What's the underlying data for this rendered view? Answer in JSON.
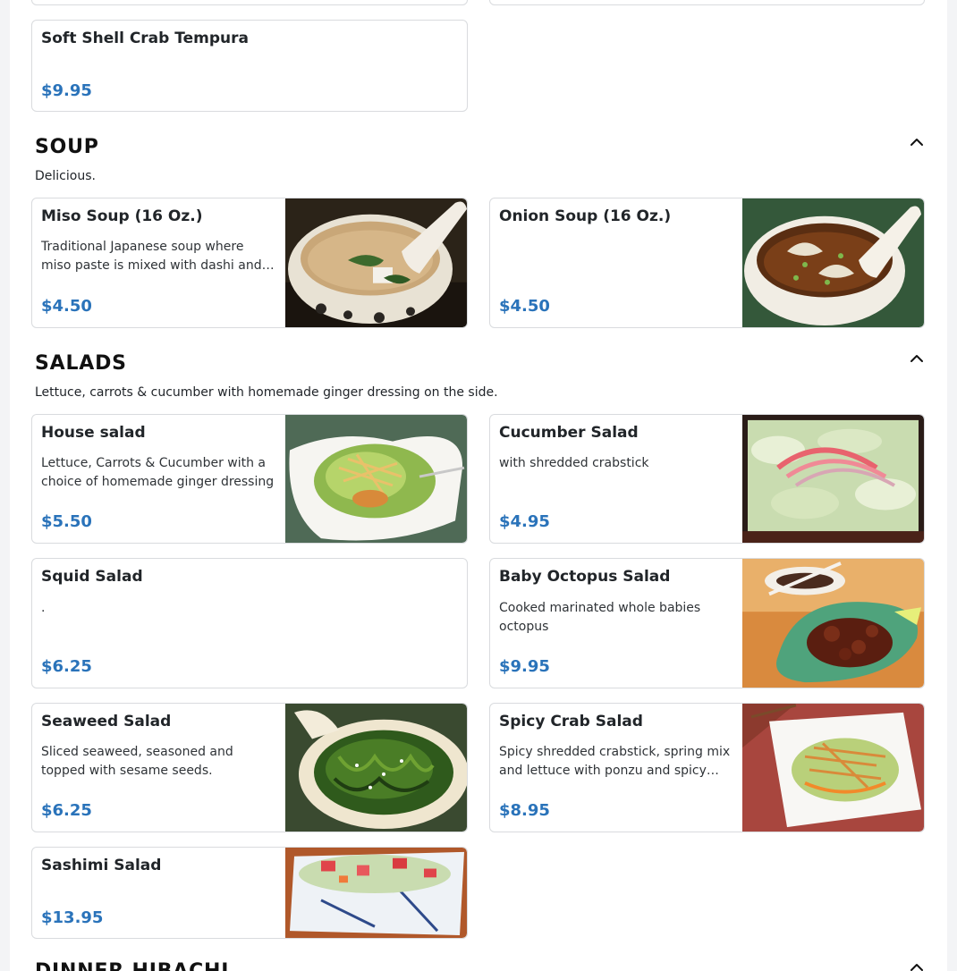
{
  "top_items": {
    "soft_shell": {
      "name": "Soft Shell Crab Tempura",
      "price": "$9.95"
    }
  },
  "sections": {
    "soup": {
      "title": "SOUP",
      "description": "Delicious.",
      "items": [
        {
          "name": "Miso Soup (16 Oz.)",
          "description": "Traditional Japanese soup where miso paste is mixed with dashi and tofu, seaweed and scallions",
          "price": "$4.50",
          "photo": "miso-soup-photo"
        },
        {
          "name": "Onion Soup (16 Oz.)",
          "description": "",
          "price": "$4.50",
          "photo": "onion-soup-photo"
        }
      ]
    },
    "salads": {
      "title": "SALADS",
      "description": "Lettuce, carrots & cucumber with homemade ginger dressing on the side.",
      "items": [
        {
          "name": "House salad",
          "description": "Lettuce, Carrots & Cucumber with a choice of homemade ginger dressing",
          "price": "$5.50",
          "photo": "house-salad-photo"
        },
        {
          "name": "Cucumber Salad",
          "description": "with shredded crabstick",
          "price": "$4.95",
          "photo": "cucumber-salad-photo"
        },
        {
          "name": "Squid Salad",
          "description": ".",
          "price": "$6.25"
        },
        {
          "name": "Baby Octopus Salad",
          "description": "Cooked marinated whole babies octopus",
          "price": "$9.95",
          "photo": "octopus-salad-photo"
        },
        {
          "name": "Seaweed Salad",
          "description": "Sliced seaweed, seasoned and topped with sesame seeds.",
          "price": "$6.25",
          "photo": "seaweed-salad-photo"
        },
        {
          "name": "Spicy Crab Salad",
          "description": "Spicy shredded crabstick, spring mix and lettuce with ponzu and spicy mayo",
          "price": "$8.95",
          "photo": "spicy-crab-salad-photo"
        },
        {
          "name": "Sashimi Salad",
          "description": "",
          "price": "$13.95",
          "photo": "sashimi-salad-photo"
        }
      ]
    },
    "dinner_hibachi": {
      "title": "DINNER HIBACHI"
    }
  },
  "colors": {
    "price": "#2a73ba",
    "border": "#d9dbde",
    "page_bg": "#ffffff",
    "outer_bg": "#f3f4f6"
  },
  "icons": {
    "collapse": "chevron-up-icon"
  }
}
